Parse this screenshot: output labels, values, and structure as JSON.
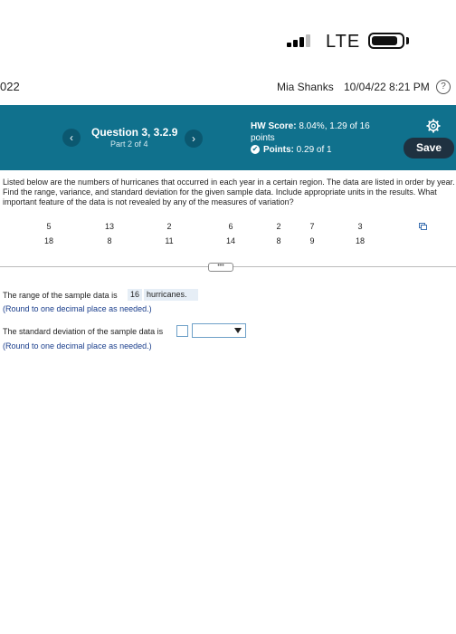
{
  "status_bar": {
    "network": "LTE"
  },
  "header": {
    "year_fragment": "022",
    "user_name": "Mia Shanks",
    "datetime": "10/04/22 8:21 PM",
    "help_symbol": "?"
  },
  "question_bar": {
    "title": "Question 3, 3.2.9",
    "part": "Part 2 of 4",
    "prev_symbol": "‹",
    "next_symbol": "›",
    "hw_score_label": "HW Score:",
    "hw_score_value": "8.04%, 1.29 of 16 points",
    "points_label": "Points:",
    "points_value": "0.29 of 1",
    "save_label": "Save",
    "accent_color": "#10718d"
  },
  "question": {
    "text": "Listed below are the numbers of hurricanes that occurred in each year in a certain region. The data are listed in order by year. Find the range, variance, and standard deviation for the given sample data. Include appropriate units in the results. What important feature of the data is not revealed by any of the measures of variation?",
    "row1": [
      "5",
      "13",
      "2",
      "6",
      "2",
      "7",
      "3"
    ],
    "row2": [
      "18",
      "8",
      "11",
      "14",
      "8",
      "9",
      "18"
    ]
  },
  "expand_symbol": "•••",
  "answers": {
    "range_prefix": "The range of the sample data is",
    "range_value": "16",
    "range_unit": "hurricanes.",
    "range_suffix": ".",
    "range_hint": "(Round to one decimal place as needed.)",
    "sd_prefix": "The standard deviation of the sample data is",
    "sd_hint": "(Round to one decimal place as needed.)"
  }
}
